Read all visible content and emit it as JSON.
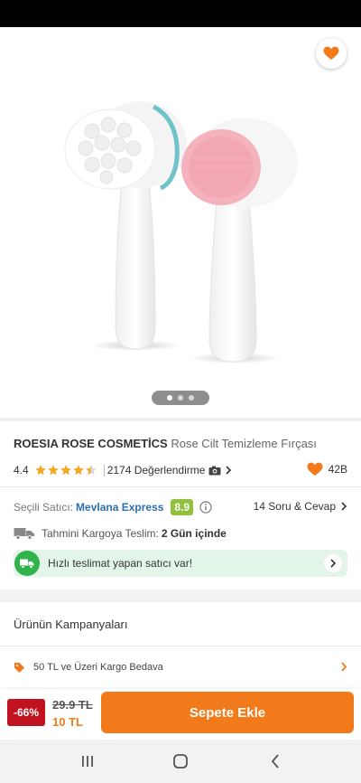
{
  "product": {
    "brand": "ROESIA ROSE COSMETİCS",
    "name": "Rose Cilt Temizleme Fırçası",
    "rating": "4.4",
    "stars_value": 4.4,
    "review_count": "2174 Değerlendirme",
    "favorite_count": "42B"
  },
  "gallery": {
    "image_count": 3,
    "active_index": 0
  },
  "seller": {
    "label": "Seçili Satıcı:",
    "name": "Mevlana Express",
    "score": "8.9",
    "qa_link": "14 Soru & Cevap"
  },
  "delivery": {
    "label": "Tahmini Kargoya Teslim:",
    "value": "2 Gün içinde"
  },
  "fast_banner": {
    "text": "Hızlı teslimat yapan satıcı var!"
  },
  "campaigns": {
    "title": "Ürünün Kampanyaları",
    "items": [
      {
        "label": "50 TL ve Üzeri Kargo Bedava"
      }
    ]
  },
  "bottom": {
    "discount": "-66%",
    "old_price": "29.9 TL",
    "new_price": "10 TL",
    "cta": "Sepete Ekle"
  },
  "icons": {
    "back": "arrow-left-icon",
    "share": "share-icon",
    "favorite": "heart-icon",
    "camera": "camera-icon",
    "info": "info-icon",
    "truck": "truck-icon",
    "tag": "tag-icon"
  },
  "colors": {
    "accent": "#f27a1a",
    "discount": "#c1121f",
    "seller_link": "#2a6fb0",
    "score_badge": "#8fc13d",
    "fast_banner_bg": "#e3f5e8",
    "fast_banner_icon": "#2fb34a"
  }
}
